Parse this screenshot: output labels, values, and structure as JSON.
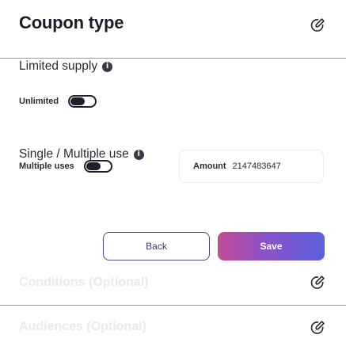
{
  "coupon_type": {
    "title": "Coupon type",
    "limited_supply": {
      "label": "Limited supply",
      "toggle_label": "Unlimited",
      "toggle_on": false
    },
    "single_multiple": {
      "label": "Single / Multiple use",
      "toggle_label": "Multiple uses",
      "toggle_on": false
    },
    "amount": {
      "label": "Amount",
      "value": "2147483647"
    }
  },
  "actions": {
    "back_label": "Back",
    "save_label": "Save"
  },
  "conditions": {
    "title": "Conditions (Optional)"
  },
  "audiences": {
    "title": "Audiences (Optional)"
  },
  "colors": {
    "accent_gradient": [
      "#c44a98",
      "#8a52c8",
      "#5a62e0"
    ],
    "text": "#1b1b2a",
    "muted": "#e9e9ef"
  }
}
